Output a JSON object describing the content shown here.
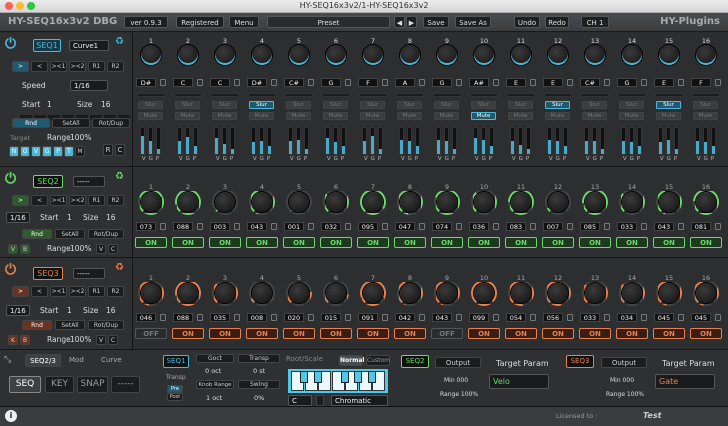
{
  "window_title": "HY-SEQ16x3v2/1-HY-SEQ16x3v2",
  "header": {
    "app_name": "HY-SEQ16x3v2 DBG",
    "version": "ver 0.9.3",
    "registered": "Registered",
    "menu": "Menu",
    "preset": "Preset",
    "prev": "◀",
    "next": "▶",
    "save": "Save",
    "save_as": "Save As",
    "undo": "Undo",
    "redo": "Redo",
    "channel": "CH 1",
    "brand": "HY-Plugins"
  },
  "seq1": {
    "name": "SEQ1",
    "curve": "Curve1",
    "dir_buttons": [
      ">",
      "<",
      "><1",
      "><2",
      "R1",
      "R2"
    ],
    "speed_label": "Speed",
    "speed": "1/16",
    "start_label": "Start",
    "start": "1",
    "size_label": "Size",
    "size": "16",
    "tabs": [
      "Rnd",
      "SetAll",
      "Rot/Dup"
    ],
    "target_label": "Target",
    "range_label": "Range",
    "range": "100%",
    "targets": [
      "N",
      "O",
      "V",
      "G",
      "P",
      "T",
      "M"
    ],
    "rc": [
      "R",
      "C"
    ],
    "steps": [
      "1",
      "2",
      "3",
      "4",
      "5",
      "6",
      "7",
      "8",
      "9",
      "10",
      "11",
      "12",
      "13",
      "14",
      "15",
      "16"
    ],
    "notes": [
      "D#",
      "C",
      "C",
      "D#",
      "C#",
      "G",
      "F",
      "A",
      "G",
      "A#",
      "E",
      "E",
      "C#",
      "G",
      "E",
      "F"
    ],
    "slur": "Slur",
    "mute": "Mute",
    "slur_active": [
      false,
      false,
      false,
      true,
      false,
      false,
      false,
      false,
      false,
      false,
      false,
      true,
      false,
      false,
      true,
      false
    ],
    "mute_active": [
      false,
      false,
      false,
      false,
      false,
      false,
      false,
      false,
      false,
      true,
      false,
      false,
      false,
      false,
      false,
      false
    ],
    "vgp": "VGP",
    "velocity": [
      0.7,
      0.5,
      0.6,
      0.45,
      0.5,
      0.6,
      0.5,
      0.55,
      0.55,
      0.6,
      0.5,
      0.55,
      0.5,
      0.5,
      0.45,
      0.5
    ],
    "gate": [
      0.5,
      0.65,
      0.4,
      0.5,
      0.55,
      0.45,
      0.7,
      0.5,
      0.5,
      0.55,
      0.35,
      0.5,
      0.5,
      0.45,
      0.55,
      0.45
    ],
    "prob": [
      0.2,
      0.3,
      0.2,
      0.3,
      0.2,
      0.3,
      0.2,
      0.3,
      0.2,
      0.3,
      0.2,
      0.3,
      0.2,
      0.3,
      0.2,
      0.3
    ]
  },
  "seq2": {
    "name": "SEQ2",
    "combo": "-----",
    "dir_buttons": [
      ">",
      "<",
      "><1",
      "><2",
      "R1",
      "R2"
    ],
    "speed": "1/16",
    "start_label": "Start",
    "start": "1",
    "size_label": "Size",
    "size": "16",
    "tabs": [
      "Rnd",
      "SetAll",
      "Rot/Dup"
    ],
    "vb": [
      "V",
      "B"
    ],
    "range_label": "Range",
    "range": "100%",
    "vc": [
      "V",
      "C"
    ],
    "values": [
      "073",
      "088",
      "003",
      "043",
      "001",
      "032",
      "095",
      "047",
      "074",
      "036",
      "083",
      "007",
      "085",
      "033",
      "043",
      "081"
    ],
    "on": [
      "ON",
      "ON",
      "ON",
      "ON",
      "ON",
      "ON",
      "ON",
      "ON",
      "ON",
      "ON",
      "ON",
      "ON",
      "ON",
      "ON",
      "ON",
      "ON"
    ]
  },
  "seq3": {
    "name": "SEQ3",
    "combo": "-----",
    "dir_buttons": [
      ">",
      "<",
      "><1",
      "><2",
      "R1",
      "R2"
    ],
    "speed": "1/16",
    "start_label": "Start",
    "start": "1",
    "size_label": "Size",
    "size": "16",
    "tabs": [
      "Rnd",
      "SetAll",
      "Rot/Dup"
    ],
    "kb": [
      "K",
      "B"
    ],
    "range_label": "Range",
    "range": "100%",
    "vc": [
      "V",
      "C"
    ],
    "values": [
      "046",
      "088",
      "035",
      "008",
      "020",
      "015",
      "091",
      "042",
      "043",
      "099",
      "054",
      "056",
      "033",
      "034",
      "045",
      "045"
    ],
    "on": [
      "OFF",
      "ON",
      "ON",
      "ON",
      "ON",
      "ON",
      "ON",
      "ON",
      "OFF",
      "ON",
      "ON",
      "ON",
      "ON",
      "ON",
      "ON",
      "ON"
    ]
  },
  "bottom": {
    "tabs": [
      "SEQ2/3",
      "Mod",
      "Curve"
    ],
    "modes": [
      "SEQ",
      "KEY",
      "SNAP",
      "-----"
    ],
    "seq1_label": "SEQ1",
    "transp_label": "Transp",
    "pre": "Pre",
    "post": "Post",
    "goct": "Goct",
    "goct_val": "0 oct",
    "transp": "Transp",
    "transp_val": "0 st",
    "knob_range": "Knob Range",
    "knob_range_val": "1 oct",
    "swing": "Swing",
    "swing_val": "0%",
    "root_scale": "Root/Scale",
    "normal": "Normal",
    "custom": "Custom",
    "root": "C",
    "scale": "Chromatic",
    "seq2": "SEQ2",
    "output": "Output",
    "min": "Min 000",
    "range": "Range 100%",
    "target_param": "Target Param",
    "target2": "Velo",
    "seq3": "SEQ3",
    "output3": "Output",
    "min3": "Min 000",
    "range3": "Range 100%",
    "target_param3": "Target Param",
    "target3": "Gate"
  },
  "footer": {
    "licensed": "Licensed to :",
    "user": "Test",
    "info": "i"
  },
  "colors": {
    "seq1": "#4ab8d8",
    "seq2": "#6ad86a",
    "seq3": "#e88050"
  }
}
